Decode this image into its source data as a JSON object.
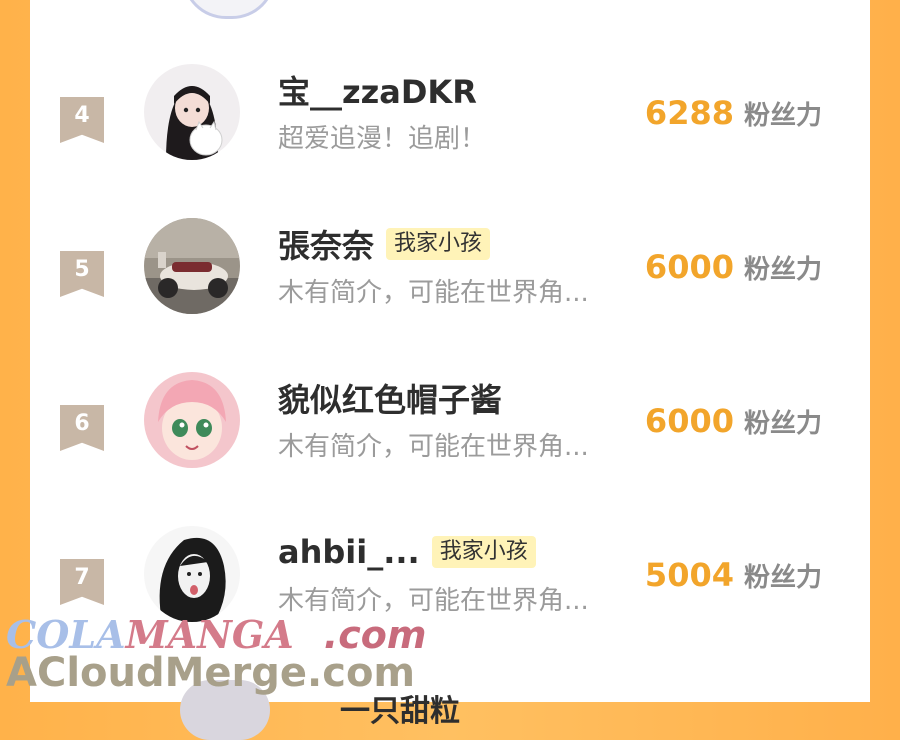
{
  "score_unit": "粉丝力",
  "rows": [
    {
      "rank": "4",
      "name": "宝__zzaDKR",
      "badge": "",
      "bio": "超爱追漫！追剧！",
      "score": "6288"
    },
    {
      "rank": "5",
      "name": "張奈奈",
      "badge": "我家小孩",
      "bio": "木有简介，可能在世界角...",
      "score": "6000"
    },
    {
      "rank": "6",
      "name": "貌似红色帽子酱",
      "badge": "",
      "bio": "木有简介，可能在世界角...",
      "score": "6000"
    },
    {
      "rank": "7",
      "name": "ahbii_...",
      "badge": "我家小孩",
      "bio": "木有简介，可能在世界角...",
      "score": "5004"
    }
  ],
  "next_partial_name": "一只甜粒",
  "watermark": {
    "line1_a": "COLA",
    "line1_b": "MANGA",
    "line1_c": ".com",
    "line2": "ACloudMerge.com"
  },
  "colors": {
    "background": "#ffb24a",
    "score": "#f2a52b",
    "rank_ribbon": "#c8b7a6",
    "badge_bg": "#fff3b8"
  }
}
